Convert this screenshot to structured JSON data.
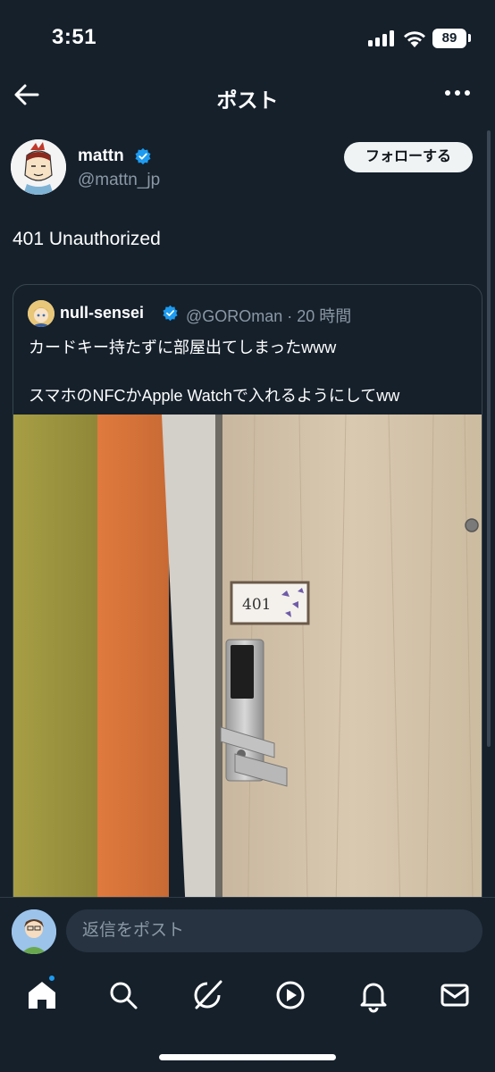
{
  "status_bar": {
    "time": "3:51",
    "battery": "89"
  },
  "header": {
    "title": "ポスト"
  },
  "author": {
    "name": "mattn",
    "handle": "@mattn_jp",
    "follow_label": "フォローする"
  },
  "post": {
    "text": "401 Unauthorized"
  },
  "quote": {
    "name": "null-sensei",
    "meta": "@GOROman · 20 時間",
    "lines": [
      "カードキー持たずに部屋出てしまったwww",
      "",
      "スマホのNFCかApple Watchで入れるようにしてww"
    ],
    "photo": {
      "room_number": "401"
    }
  },
  "reply": {
    "placeholder": "返信をポスト"
  },
  "tabs": [
    "home-icon",
    "search-icon",
    "grok-icon",
    "video-icon",
    "notifications-icon",
    "messages-icon"
  ],
  "colors": {
    "background": "#15202b",
    "accent": "#1d9bf0",
    "muted_text": "#8b98a5",
    "border": "#38444d"
  }
}
